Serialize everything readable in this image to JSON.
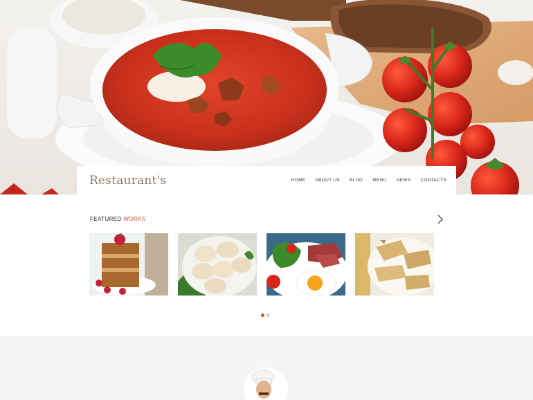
{
  "header": {
    "logo": "Restaurant's",
    "nav": [
      "HOME",
      "ABOUT US",
      "BLOG",
      "MENU",
      "NEWS",
      "CONTACTS"
    ]
  },
  "featured": {
    "title_main": "FEATURED",
    "title_accent": "WORKS",
    "thumbnails": [
      "dessert-cake",
      "dumplings",
      "fried-egg-breakfast",
      "crepes"
    ],
    "pagination": {
      "pages": 2,
      "active": 1
    }
  },
  "colors": {
    "accent": "#d2522a",
    "logo": "#8a7b63",
    "section_bg": "#f4f4f4"
  }
}
